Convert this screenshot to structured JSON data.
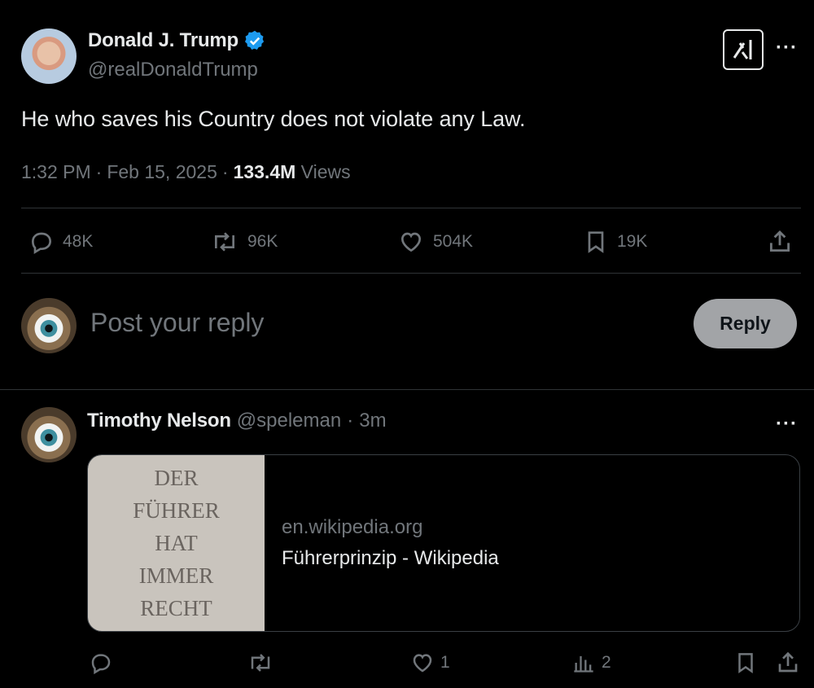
{
  "post": {
    "author_name": "Donald J. Trump",
    "author_handle": "@realDonaldTrump",
    "verified_icon": "verified-badge-icon",
    "text": "He who saves his Country does not violate any Law.",
    "time": "1:32 PM",
    "date": "Feb 15, 2025",
    "views_count": "133.4M",
    "views_label": "Views",
    "separator": "·",
    "stats": {
      "replies": "48K",
      "reposts": "96K",
      "likes": "504K",
      "bookmarks": "19K"
    }
  },
  "composer": {
    "placeholder": "Post your reply",
    "button_label": "Reply"
  },
  "reply": {
    "author_name": "Timothy Nelson",
    "author_handle": "@speleman",
    "separator": "·",
    "time": "3m",
    "card": {
      "thumbnail_lines": [
        "DER",
        "FÜHRER",
        "HAT",
        "IMMER",
        "RECHT"
      ],
      "domain": "en.wikipedia.org",
      "title": "Führerprinzip - Wikipedia"
    },
    "stats": {
      "likes": "1",
      "views": "2"
    }
  },
  "more_label": "···",
  "colors": {
    "background": "#000000",
    "primary_text": "#e7e9ea",
    "secondary_text": "#71767b",
    "verified": "#1d9bf0",
    "divider": "#2f3336",
    "reply_button": "#a2a4a7"
  }
}
